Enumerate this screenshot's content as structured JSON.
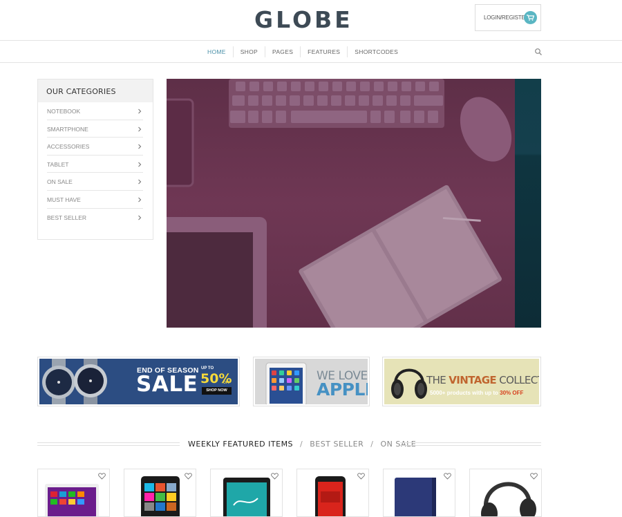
{
  "header": {
    "logo_text": "GLOBE",
    "login_label": "LOGIN/REGISTER"
  },
  "nav": {
    "items": [
      {
        "label": "HOME"
      },
      {
        "label": "SHOP"
      },
      {
        "label": "PAGES"
      },
      {
        "label": "FEATURES"
      },
      {
        "label": "SHORTCODES"
      }
    ]
  },
  "sidebar": {
    "title": "OUR CATEGORIES",
    "items": [
      {
        "label": "NOTEBOOK"
      },
      {
        "label": "SMARTPHONE"
      },
      {
        "label": "ACCESSORIES"
      },
      {
        "label": "TABLET"
      },
      {
        "label": "ON SALE"
      },
      {
        "label": "MUST HAVE"
      },
      {
        "label": "BEST SELLER"
      }
    ]
  },
  "banners": {
    "sale": {
      "line1": "END OF SEASON",
      "line2": "SALE",
      "upto": "UP TO",
      "percent": "50%",
      "off": "OFF",
      "button": "SHOP NOW"
    },
    "apple": {
      "line1": "WE LOVE",
      "line2": "APPLE"
    },
    "vintage": {
      "title_pre": "THE ",
      "title_em": "VINTAGE",
      "title_post": " COLLECTION",
      "sub_pre": "5000+ products with up to ",
      "sub_em": "30% OFF"
    }
  },
  "product_tabs": {
    "items": [
      {
        "label": "WEEKLY FEATURED ITEMS",
        "active": true
      },
      {
        "label": "BEST SELLER",
        "active": false
      },
      {
        "label": "ON SALE",
        "active": false
      }
    ],
    "separator": "/"
  },
  "products": [
    {
      "icon": "laptop"
    },
    {
      "icon": "windows-phone"
    },
    {
      "icon": "tablet"
    },
    {
      "icon": "smartphone"
    },
    {
      "icon": "ereader-cover"
    },
    {
      "icon": "headphones"
    }
  ],
  "colors": {
    "accent": "#5ab6c3",
    "logo_dark": "#3d4a55",
    "hero_overlay": "#6b3450"
  }
}
